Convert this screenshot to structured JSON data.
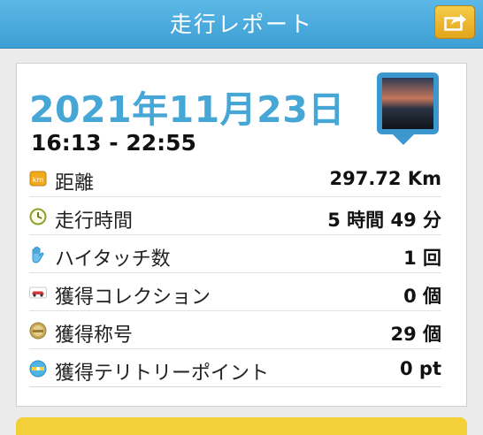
{
  "header": {
    "title": "走行レポート",
    "share_icon": "share-icon"
  },
  "report": {
    "date": "2021年11月23日",
    "time_range": "16:13 - 22:55",
    "photo_icon": "photo-thumbnail",
    "rows": [
      {
        "icon": "km-icon",
        "label": "距離",
        "value": "297.72 Km"
      },
      {
        "icon": "clock-icon",
        "label": "走行時間",
        "value": "5 時間 49 分"
      },
      {
        "icon": "hand-icon",
        "label": "ハイタッチ数",
        "value": "1 回"
      },
      {
        "icon": "car-icon",
        "label": "獲得コレクション",
        "value": "0 個"
      },
      {
        "icon": "medal-icon",
        "label": "獲得称号",
        "value": "29 個"
      },
      {
        "icon": "spot-icon",
        "label": "獲得テリトリーポイント",
        "value": "0 pt"
      }
    ]
  },
  "colors": {
    "header": "#4aa9dc",
    "date": "#46a6d6",
    "accent": "#f3cf39"
  }
}
